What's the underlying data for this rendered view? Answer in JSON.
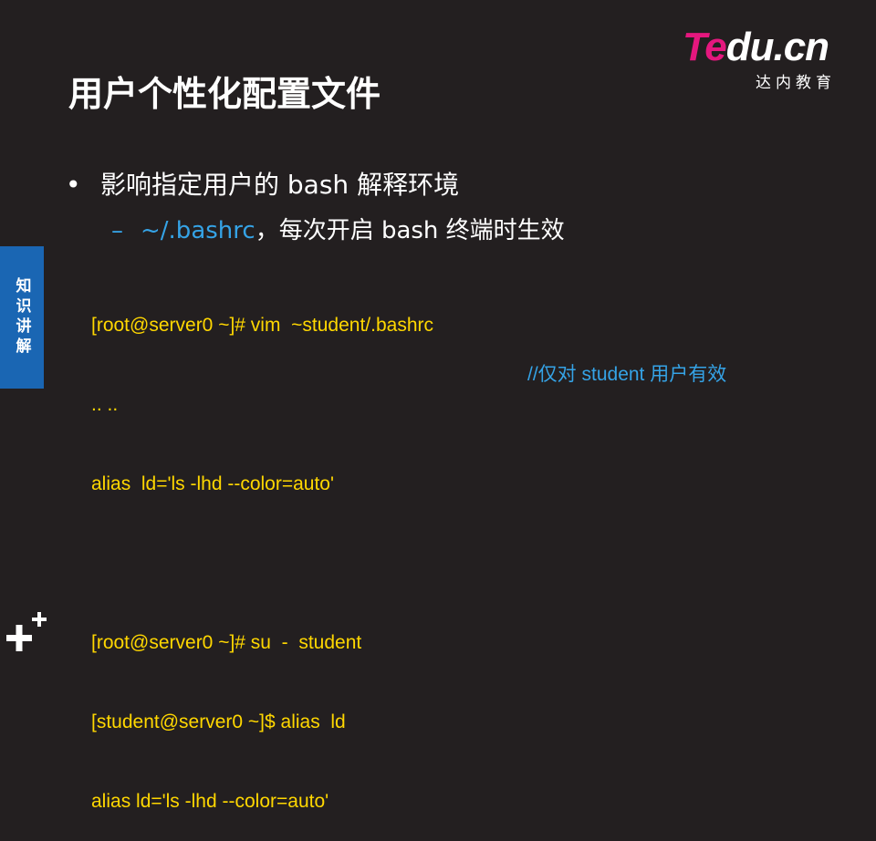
{
  "logo": {
    "brand_part1": "Te",
    "brand_part2": "du.cn",
    "subtitle": "达内教育"
  },
  "title": "用户个性化配置文件",
  "side_tab": "知识讲解",
  "bullet1": {
    "text": "影响指定用户的 bash 解释环境"
  },
  "bullet2": {
    "highlight": "~/.bashrc",
    "text": "，每次开启 bash 终端时生效"
  },
  "code_lines": [
    "[root@server0 ~]# vim  ~student/.bashrc",
    ".. ..",
    "alias  ld='ls -lhd --color=auto'",
    "",
    "[root@server0 ~]# su  -  student",
    "[student@server0 ~]$ alias  ld",
    "alias ld='ls -lhd --color=auto'"
  ],
  "comment": "//仅对 student 用户有效",
  "colors": {
    "background": "#231f20",
    "accent_blue": "#35a3e6",
    "code_yellow": "#ffd700",
    "brand_pink": "#e5177e",
    "tab_blue": "#1a66b3"
  },
  "icons": {
    "logo": "tedu-logo",
    "bottom": "plus-icon"
  }
}
